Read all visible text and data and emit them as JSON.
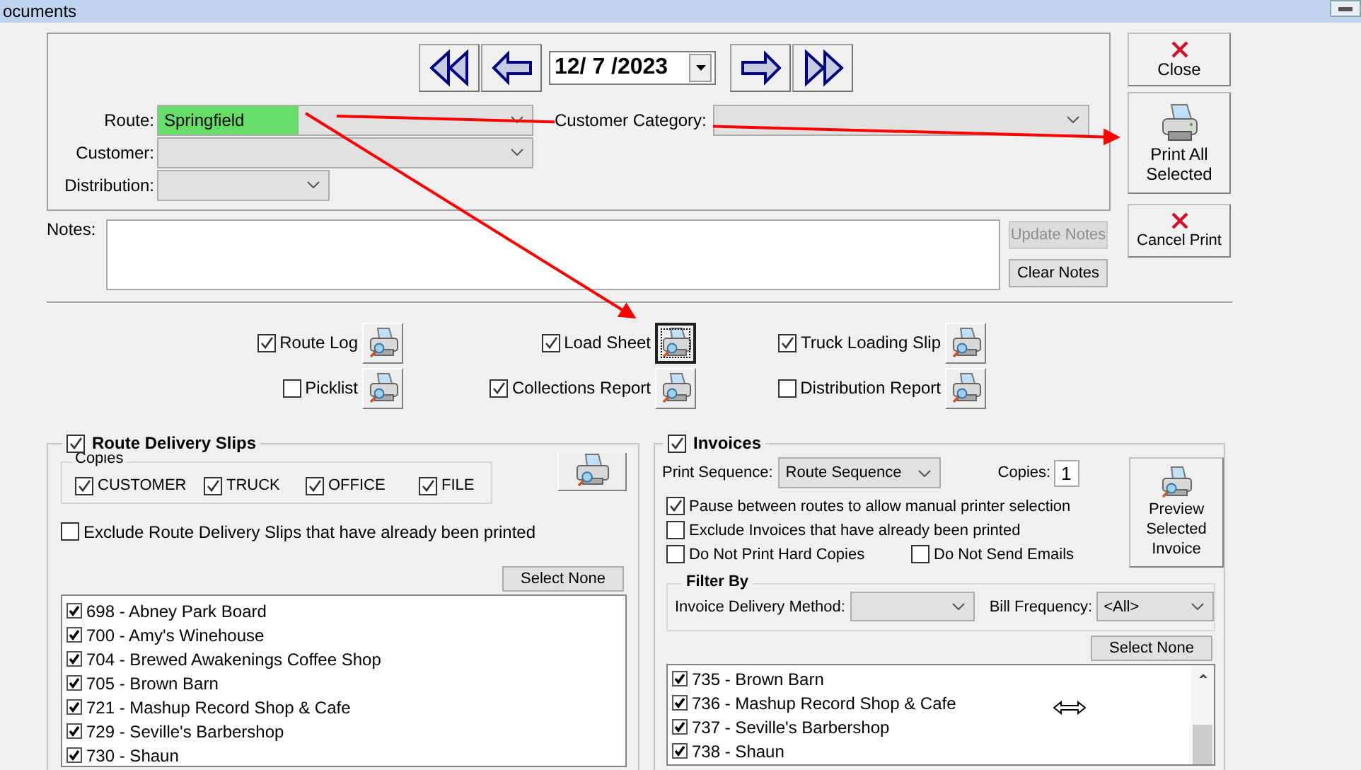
{
  "window": {
    "title": "ocuments"
  },
  "navigation": {
    "date": "12/ 7 /2023"
  },
  "filters": {
    "route": {
      "label": "Route:",
      "value": "Springfield",
      "highlighted": true
    },
    "customer_category": {
      "label": "Customer Category:"
    },
    "customer": {
      "label": "Customer:"
    },
    "distribution": {
      "label": "Distribution:"
    }
  },
  "side_buttons": [
    {
      "label": "Close",
      "kind": "close"
    },
    {
      "label": "Print All Selected",
      "kind": "print"
    },
    {
      "label": "Cancel Print",
      "kind": "close"
    }
  ],
  "notes": {
    "label": "Notes:",
    "buttons": [
      {
        "label": "Update Notes",
        "disabled": true
      },
      {
        "label": "Clear Notes",
        "disabled": false
      }
    ]
  },
  "reports": [
    {
      "label": "Route Log",
      "checked": true,
      "focused": false
    },
    {
      "label": "Load Sheet",
      "checked": true,
      "focused": true
    },
    {
      "label": "Truck Loading Slip",
      "checked": true,
      "focused": false
    },
    {
      "label": "Picklist",
      "checked": false,
      "focused": false
    },
    {
      "label": "Collections Report",
      "checked": true,
      "focused": false
    },
    {
      "label": "Distribution Report",
      "checked": false,
      "focused": false
    }
  ],
  "route_delivery_slips": {
    "title": "Route Delivery Slips",
    "checked": true,
    "copies_label": "Copies",
    "copies": [
      {
        "label": "CUSTOMER",
        "checked": true
      },
      {
        "label": "TRUCK",
        "checked": true
      },
      {
        "label": "OFFICE",
        "checked": true
      },
      {
        "label": "FILE",
        "checked": true
      }
    ],
    "exclude": {
      "label": "Exclude Route Delivery Slips that have already been printed",
      "checked": false
    },
    "select_none": "Select None",
    "items": [
      {
        "label": "698 - Abney Park Board",
        "checked": true
      },
      {
        "label": "700 - Amy's Winehouse",
        "checked": true
      },
      {
        "label": "704 - Brewed Awakenings Coffee Shop",
        "checked": true
      },
      {
        "label": "705 - Brown Barn",
        "checked": true
      },
      {
        "label": "721 - Mashup Record Shop & Cafe",
        "checked": true
      },
      {
        "label": "729 - Seville's Barbershop",
        "checked": true
      },
      {
        "label": "730 - Shaun",
        "checked": true
      }
    ]
  },
  "invoices": {
    "title": "Invoices",
    "checked": true,
    "print_sequence": {
      "label": "Print Sequence:",
      "value": "Route Sequence"
    },
    "copies": {
      "label": "Copies:",
      "value": "1"
    },
    "preview_button": "Preview Selected Invoice",
    "options": [
      {
        "label": "Pause between routes to allow manual printer selection",
        "checked": true
      },
      {
        "label": "Exclude Invoices that have already been printed",
        "checked": false
      },
      {
        "label": "Do Not Print Hard Copies",
        "checked": false
      },
      {
        "label": "Do Not Send Emails",
        "checked": false
      }
    ],
    "filter": {
      "title": "Filter By",
      "delivery_method": {
        "label": "Invoice Delivery Method:"
      },
      "bill_frequency": {
        "label": "Bill Frequency:",
        "value": "<All>"
      }
    },
    "select_none": "Select None",
    "items": [
      {
        "label": "735 - Brown Barn",
        "checked": true
      },
      {
        "label": "736 - Mashup Record Shop & Cafe",
        "checked": true
      },
      {
        "label": "737 - Seville's Barbershop",
        "checked": true
      },
      {
        "label": "738 - Shaun",
        "checked": true
      }
    ]
  }
}
